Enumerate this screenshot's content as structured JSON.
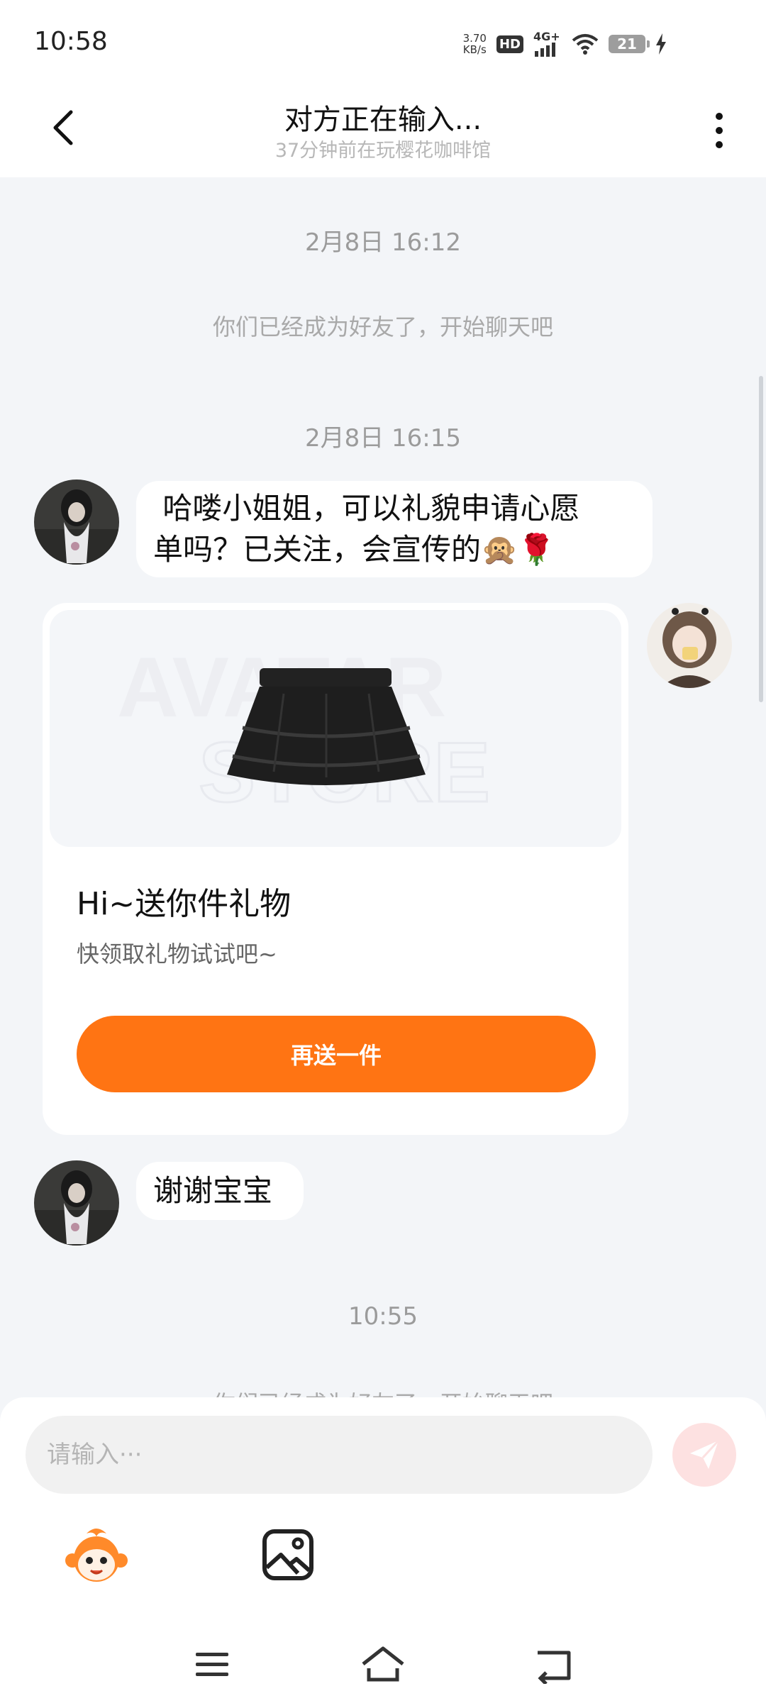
{
  "status_bar": {
    "time": "10:58",
    "net_speed_value": "3.70",
    "net_speed_unit": "KB/s",
    "hd": "HD",
    "network": "4G+",
    "battery": "21"
  },
  "header": {
    "title": "对方正在输入...",
    "subtitle": "37分钟前在玩樱花咖啡馆"
  },
  "chat": {
    "timestamp_1": "2月8日 16:12",
    "friend_note_1": "你们已经成为好友了，开始聊天吧",
    "timestamp_2": "2月8日 16:15",
    "message_1_line1": " 哈喽小姐姐，可以礼貌申请心愿",
    "message_1_line2": "单吗？已关注，会宣传的🙊🌹",
    "gift_card": {
      "watermark_line1": "AVATAR",
      "watermark_line2": "STORE",
      "title": "Hi~送你件礼物",
      "description": "快领取礼物试试吧~",
      "button_label": "再送一件"
    },
    "message_2": "谢谢宝宝",
    "timestamp_3": "10:55",
    "friend_note_2": "你们已经成为好友了，开始聊天吧"
  },
  "input": {
    "placeholder": "请输入···"
  },
  "colors": {
    "accent": "#ff7413",
    "background": "#f3f5f8",
    "send_disabled": "#fde1e1"
  }
}
